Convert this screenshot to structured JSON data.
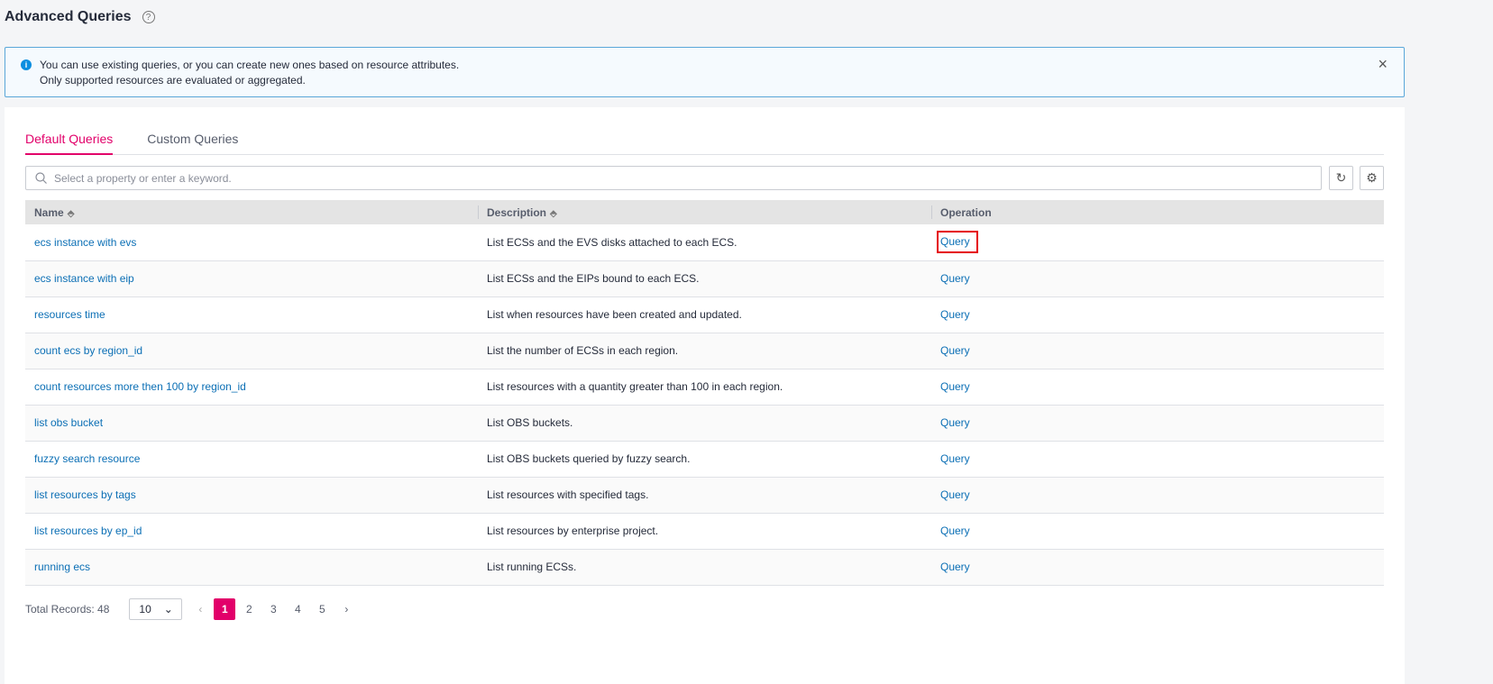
{
  "header": {
    "title": "Advanced Queries",
    "help_icon": "question-circle-icon"
  },
  "alert": {
    "line1": "You can use existing queries, or you can create new ones based on resource attributes.",
    "line2": "Only supported resources are evaluated or aggregated.",
    "close": "×"
  },
  "tabs": [
    {
      "label": "Default Queries",
      "active": true
    },
    {
      "label": "Custom Queries",
      "active": false
    }
  ],
  "search": {
    "placeholder": "Select a property or enter a keyword."
  },
  "table": {
    "columns": [
      "Name",
      "Description",
      "Operation"
    ],
    "rows": [
      {
        "name": "ecs instance with evs",
        "description": "List ECSs and the EVS disks attached to each ECS.",
        "operation": "Query"
      },
      {
        "name": "ecs instance with eip",
        "description": "List ECSs and the EIPs bound to each ECS.",
        "operation": "Query"
      },
      {
        "name": "resources time",
        "description": "List when resources have been created and updated.",
        "operation": "Query"
      },
      {
        "name": "count ecs by region_id",
        "description": "List the number of ECSs in each region.",
        "operation": "Query"
      },
      {
        "name": "count resources more then 100 by region_id",
        "description": "List resources with a quantity greater than 100 in each region.",
        "operation": "Query"
      },
      {
        "name": "list obs bucket",
        "description": "List OBS buckets.",
        "operation": "Query"
      },
      {
        "name": "fuzzy search resource",
        "description": "List OBS buckets queried by fuzzy search.",
        "operation": "Query"
      },
      {
        "name": "list resources by tags",
        "description": "List resources with specified tags.",
        "operation": "Query"
      },
      {
        "name": "list resources by ep_id",
        "description": "List resources by enterprise project.",
        "operation": "Query"
      },
      {
        "name": "running ecs",
        "description": "List running ECSs.",
        "operation": "Query"
      }
    ]
  },
  "pagination": {
    "total": "Total Records: 48",
    "page_size": "10",
    "pages": [
      "1",
      "2",
      "3",
      "4",
      "5"
    ],
    "current": "1"
  },
  "colors": {
    "accent": "#e2006a",
    "link": "#0b6fb5",
    "highlight": "#e5000a"
  }
}
